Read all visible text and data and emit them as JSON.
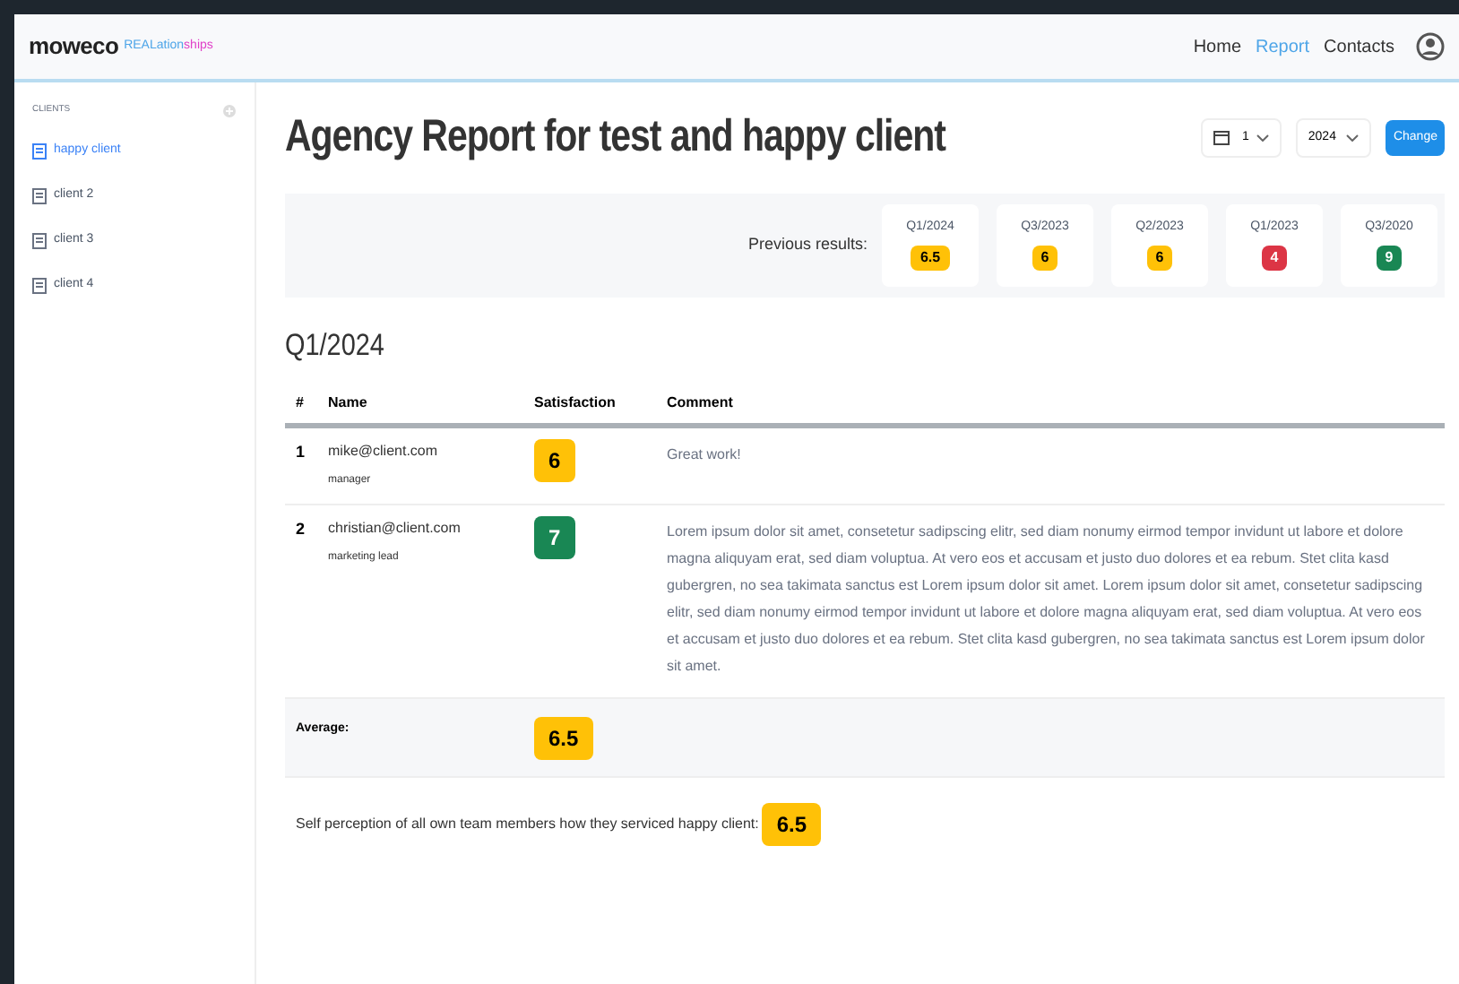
{
  "brand": {
    "logo": "moweco",
    "tagline_part1": "REALation",
    "tagline_part2": "ships"
  },
  "nav": [
    {
      "label": "Home",
      "selected": false
    },
    {
      "label": "Report",
      "selected": true
    },
    {
      "label": "Contacts",
      "selected": false
    }
  ],
  "sidebar": {
    "heading": "CLIENTS",
    "items": [
      {
        "label": "happy client",
        "selected": true
      },
      {
        "label": "client 2",
        "selected": false
      },
      {
        "label": "client 3",
        "selected": false
      },
      {
        "label": "client 4",
        "selected": false
      }
    ]
  },
  "title": "Agency Report for test and happy client",
  "filters": {
    "quarter": "1",
    "year": "2024",
    "button": "Change"
  },
  "previous": {
    "label": "Previous results:",
    "items": [
      {
        "period": "Q1/2024",
        "score": "6.5",
        "color": "#ffc107"
      },
      {
        "period": "Q3/2023",
        "score": "6",
        "color": "#ffc107"
      },
      {
        "period": "Q2/2023",
        "score": "6",
        "color": "#ffc107"
      },
      {
        "period": "Q1/2023",
        "score": "4",
        "color": "#dc3545"
      },
      {
        "period": "Q3/2020",
        "score": "9",
        "color": "#198754"
      }
    ]
  },
  "section": "Q1/2024",
  "table": {
    "columns": [
      "#",
      "Name",
      "Satisfaction",
      "Comment"
    ],
    "rows": [
      {
        "index": "1",
        "email": "mike@client.com",
        "role": "manager",
        "score": "6",
        "color": "#ffc107",
        "comment": "Great work!"
      },
      {
        "index": "2",
        "email": "christian@client.com",
        "role": "marketing lead",
        "score": "7",
        "color": "#198754",
        "comment": "Lorem ipsum dolor sit amet, consetetur sadipscing elitr, sed diam nonumy eirmod tempor invidunt ut labore et dolore magna aliquyam erat, sed diam voluptua. At vero eos et accusam et justo duo dolores et ea rebum. Stet clita kasd gubergren, no sea takimata sanctus est Lorem ipsum dolor sit amet. Lorem ipsum dolor sit amet, consetetur sadipscing elitr, sed diam nonumy eirmod tempor invidunt ut labore et dolore magna aliquyam erat, sed diam voluptua. At vero eos et accusam et justo duo dolores et ea rebum. Stet clita kasd gubergren, no sea takimata sanctus est Lorem ipsum dolor sit amet."
      }
    ],
    "average": {
      "label": "Average:",
      "score": "6.5",
      "color": "#ffc107"
    }
  },
  "self_perception": {
    "text": "Self perception of all own team members how they serviced happy client:",
    "score": "6.5",
    "color": "#ffc107"
  }
}
